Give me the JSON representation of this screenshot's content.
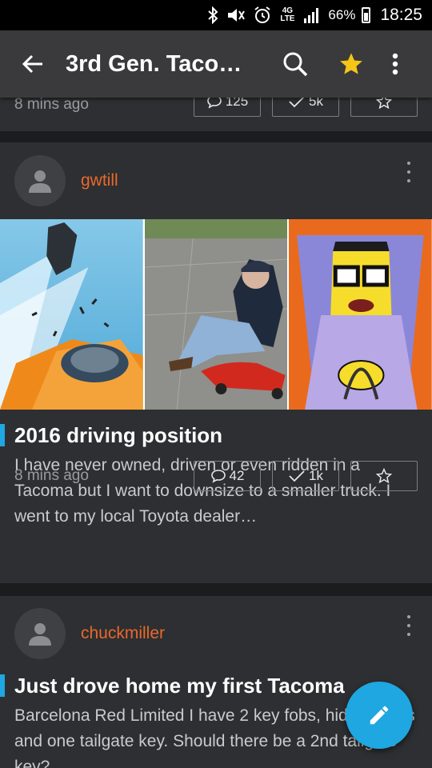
{
  "status_bar": {
    "icons": [
      "bluetooth-icon",
      "mute-icon",
      "alarm-icon",
      "lte-icon",
      "signal-icon"
    ],
    "network_label": "4G LTE",
    "battery_percent": "66%",
    "time": "18:25"
  },
  "app_bar": {
    "title": "3rd Gen. Tacom…",
    "icons": [
      "back-arrow-icon",
      "search-icon",
      "star-icon",
      "more-vert-icon"
    ],
    "star_color": "#f5c518"
  },
  "colors": {
    "username": "#e9682c",
    "accent_bar": "#1ea7e1",
    "fab": "#1ea7e1",
    "card_bg": "#2d2f32",
    "app_bar_bg": "#3a3a3c"
  },
  "posts": [
    {
      "timestamp": "8 mins ago",
      "comments": "125",
      "likes": "5k"
    },
    {
      "username": "gwtill",
      "images": [
        "jet-ejection-image",
        "man-on-plasma-car-image",
        "cartoon-driver-image"
      ],
      "title": "2016 driving position",
      "body": "I have never owned, driven or even ridden in a Tacoma but I want to downsize to a smaller truck. I went to my local Toyota dealer…",
      "timestamp": "8 mins ago",
      "comments": "42",
      "likes": "1k"
    },
    {
      "username": "chuckmiller",
      "title": "Just drove home my first Tacoma",
      "body": "Barcelona Red Limited I have 2 key fobs, hidden keys and one tailgate key. Should there be a 2nd tailgate key?"
    }
  ],
  "fab": {
    "icon": "pencil-icon"
  }
}
